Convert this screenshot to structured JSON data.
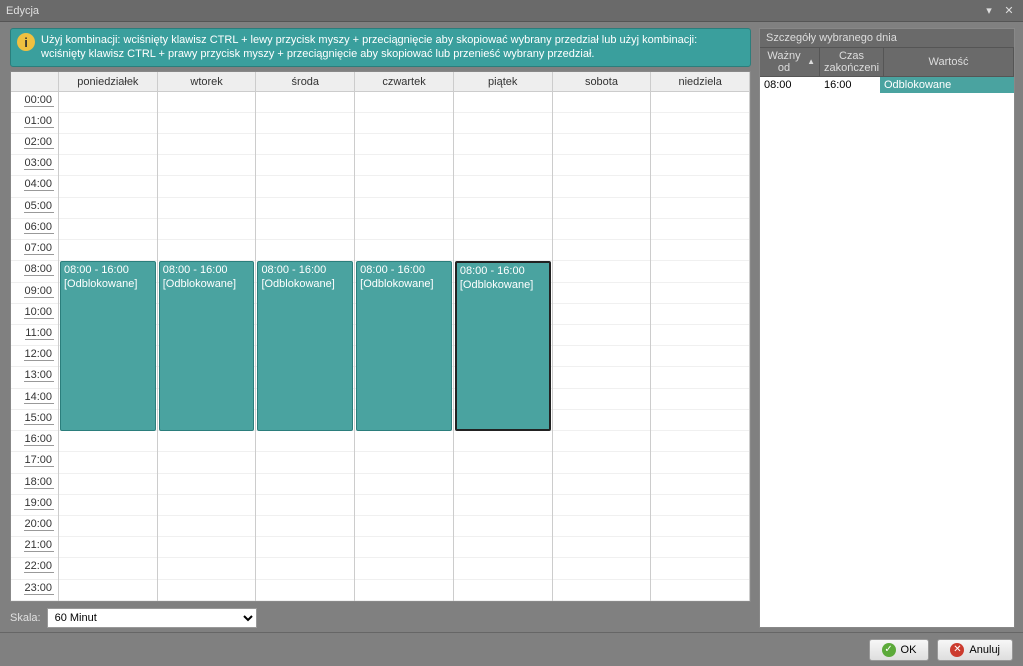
{
  "window": {
    "title": "Edycja"
  },
  "info": {
    "text": "Użyj kombinacji: wciśnięty klawisz CTRL + lewy przycisk myszy + przeciągnięcie aby skopiować wybrany przedział lub użyj kombinacji: wciśnięty klawisz CTRL + prawy przycisk myszy + przeciągnięcie aby skopiować lub przenieść wybrany przedział."
  },
  "days": [
    "poniedziałek",
    "wtorek",
    "środa",
    "czwartek",
    "piątek",
    "sobota",
    "niedziela"
  ],
  "hours": [
    "00:00",
    "01:00",
    "02:00",
    "03:00",
    "04:00",
    "05:00",
    "06:00",
    "07:00",
    "08:00",
    "09:00",
    "10:00",
    "11:00",
    "12:00",
    "13:00",
    "14:00",
    "15:00",
    "16:00",
    "17:00",
    "18:00",
    "19:00",
    "20:00",
    "21:00",
    "22:00",
    "23:00"
  ],
  "events": [
    {
      "day": 0,
      "start": 8,
      "end": 16,
      "time": "08:00 - 16:00",
      "label": "[Odblokowane]",
      "selected": false
    },
    {
      "day": 1,
      "start": 8,
      "end": 16,
      "time": "08:00 - 16:00",
      "label": "[Odblokowane]",
      "selected": false
    },
    {
      "day": 2,
      "start": 8,
      "end": 16,
      "time": "08:00 - 16:00",
      "label": "[Odblokowane]",
      "selected": false
    },
    {
      "day": 3,
      "start": 8,
      "end": 16,
      "time": "08:00 - 16:00",
      "label": "[Odblokowane]",
      "selected": false
    },
    {
      "day": 4,
      "start": 8,
      "end": 16,
      "time": "08:00 - 16:00",
      "label": "[Odblokowane]",
      "selected": true
    }
  ],
  "scale": {
    "label": "Skala:",
    "value": "60 Minut"
  },
  "details": {
    "title": "Szczegóły wybranego dnia",
    "columns": {
      "from": "Ważny od",
      "to": "Czas zakończeni",
      "value": "Wartość"
    },
    "rows": [
      {
        "from": "08:00",
        "to": "16:00",
        "value": "Odblokowane"
      }
    ]
  },
  "buttons": {
    "ok": "OK",
    "cancel": "Anuluj"
  }
}
